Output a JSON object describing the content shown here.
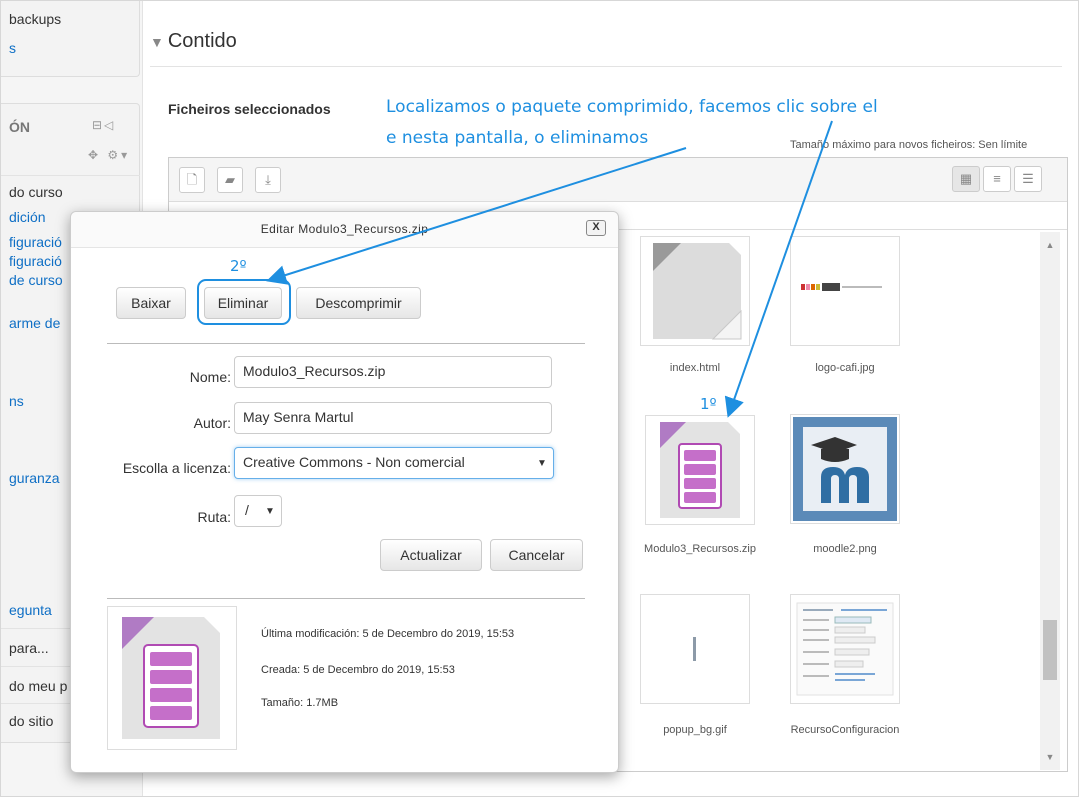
{
  "sidebar": {
    "block1": [
      "backups",
      "s"
    ],
    "heading": "ÓN",
    "items": [
      "do curso",
      "dición",
      "figuració",
      "figuració",
      "de curso",
      "arme de",
      "ns",
      "guranza",
      "egunta",
      "para...",
      "do meu p",
      "do sitio"
    ]
  },
  "section": {
    "title": "Contido",
    "files_label": "Ficheiros seleccionados",
    "max_size": "Tamaño máximo para novos ficheiros: Sen límite"
  },
  "files": [
    {
      "name": "index.html"
    },
    {
      "name": "logo-cafi.jpg"
    },
    {
      "name": "Modulo3_Recursos.zip"
    },
    {
      "name": "moodle2.png"
    },
    {
      "name": "popup_bg.gif"
    },
    {
      "name": "RecursoConfiguracion"
    }
  ],
  "dialog": {
    "title": "Editar Modulo3_Recursos.zip",
    "close": "X",
    "buttons": {
      "download": "Baixar",
      "delete": "Eliminar",
      "unzip": "Descomprimir",
      "update": "Actualizar",
      "cancel": "Cancelar"
    },
    "fields": {
      "name_label": "Nome:",
      "name_value": "Modulo3_Recursos.zip",
      "author_label": "Autor:",
      "author_value": "May Senra Martul",
      "license_label": "Escolla a licenza:",
      "license_value": "Creative Commons - Non comercial",
      "path_label": "Ruta:",
      "path_value": "/"
    },
    "info": {
      "modified": "Última modificación: 5 de Decembro do 2019, 15:53",
      "created": "Creada: 5 de Decembro do 2019, 15:53",
      "size": "Tamaño: 1.7MB"
    }
  },
  "annotations": {
    "line1": "Localizamos o paquete comprimido, facemos clic sobre el",
    "line2": "e nesta pantalla, o eliminamos",
    "step1": "1º",
    "step2": "2º",
    "color": "#1e8fe0"
  }
}
